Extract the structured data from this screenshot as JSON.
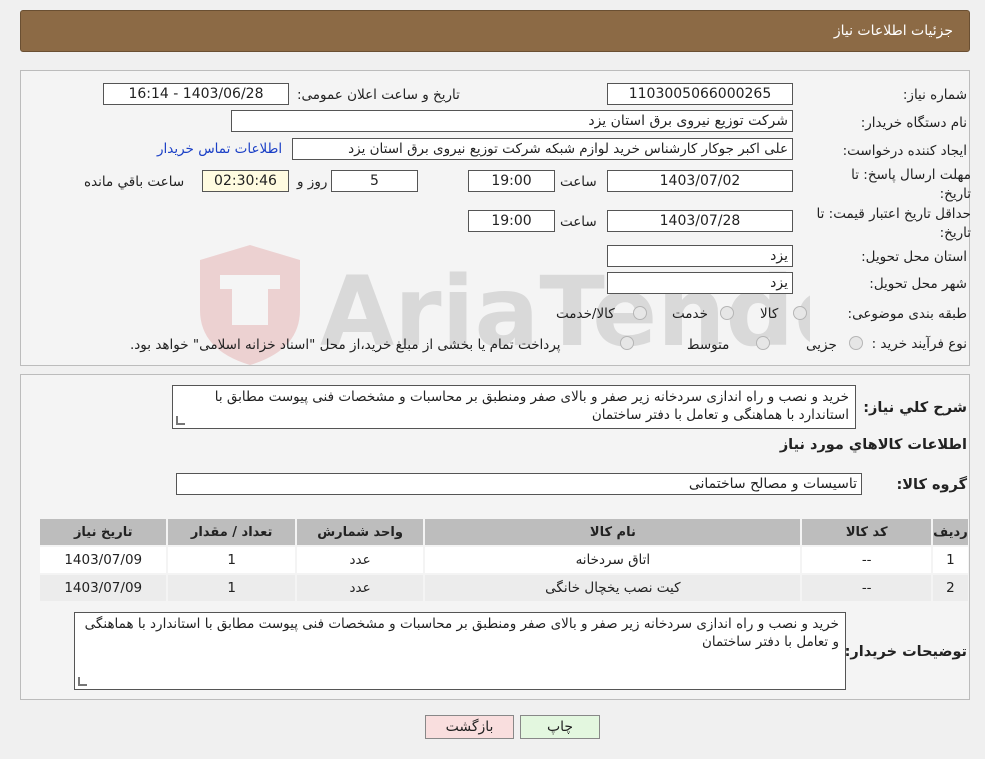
{
  "header": {
    "title": "جزئیات اطلاعات نیاز"
  },
  "watermark": {
    "text": "AriaTender.neT"
  },
  "form": {
    "need_number_label": "شماره نیاز:",
    "need_number": "1103005066000265",
    "announce_label": "تاریخ و ساعت اعلان عمومی:",
    "announce_value": "1403/06/28 - 16:14",
    "buyer_org_label": "نام دستگاه خریدار:",
    "buyer_org": "شرکت توزیع نیروی برق استان یزد",
    "creator_label": "ایجاد کننده درخواست:",
    "creator": "علی اکبر  جوکار  کارشناس خرید لوازم شبکه  شرکت توزیع نیروی برق استان یزد",
    "contact_link": "اطلاعات تماس خریدار",
    "deadline_label": "مهلت ارسال پاسخ: تا تاریخ:",
    "deadline_date": "1403/07/02",
    "time_label": "ساعت",
    "deadline_time": "19:00",
    "days_value": "5",
    "days_label": "روز و",
    "remaining_time": "02:30:46",
    "remaining_label": "ساعت باقي مانده",
    "validity_label": "حداقل تاریخ اعتبار قیمت: تا تاریخ:",
    "validity_date": "1403/07/28",
    "validity_time": "19:00",
    "province_label": "استان محل تحویل:",
    "province": "یزد",
    "city_label": "شهر محل تحویل:",
    "city": "یزد",
    "category_label": "طبقه بندی موضوعی:",
    "category_options": [
      "کالا",
      "خدمت",
      "کالا/خدمت"
    ],
    "process_label": "نوع فرآیند خرید :",
    "process_options": [
      "جزیی",
      "متوسط"
    ],
    "process_note": "پرداخت تمام یا بخشی از مبلغ خرید،از محل \"اسناد خزانه اسلامی\" خواهد بود."
  },
  "summary": {
    "label": "شرح كلي نياز:",
    "text": "خرید و نصب و راه اندازی سردخانه زیر صفر و بالای صفر ومنطبق بر  محاسبات و مشخصات فنی پیوست مطابق با استاندارد با هماهنگی  و تعامل با دفتر ساختمان",
    "items_title": "اطلاعات كالاهاي مورد نياز",
    "group_label": "گروه کالا:",
    "group_value": "تاسیسات و مصالح ساختمانی"
  },
  "table": {
    "headers": [
      "رديف",
      "کد کالا",
      "نام کالا",
      "واحد شمارش",
      "تعداد / مقدار",
      "تاریخ نیاز"
    ],
    "rows": [
      [
        "1",
        "--",
        "اتاق سردخانه",
        "عدد",
        "1",
        "1403/07/09"
      ],
      [
        "2",
        "--",
        "کیت نصب یخچال خانگی",
        "عدد",
        "1",
        "1403/07/09"
      ]
    ]
  },
  "buyer_notes": {
    "label": "توضیحات خریدار:",
    "text": "خرید و نصب و راه اندازی سردخانه زیر صفر و بالای صفر ومنطبق بر  محاسبات و مشخصات فنی پیوست مطابق با استاندارد با هماهنگی  و تعامل با دفتر ساختمان"
  },
  "buttons": {
    "print": "چاپ",
    "back": "بازگشت"
  },
  "colors": {
    "header_bg": "#8c6a45",
    "print_bg": "#e3f7df",
    "back_bg": "#f9dede",
    "link": "#1a3fc6"
  }
}
